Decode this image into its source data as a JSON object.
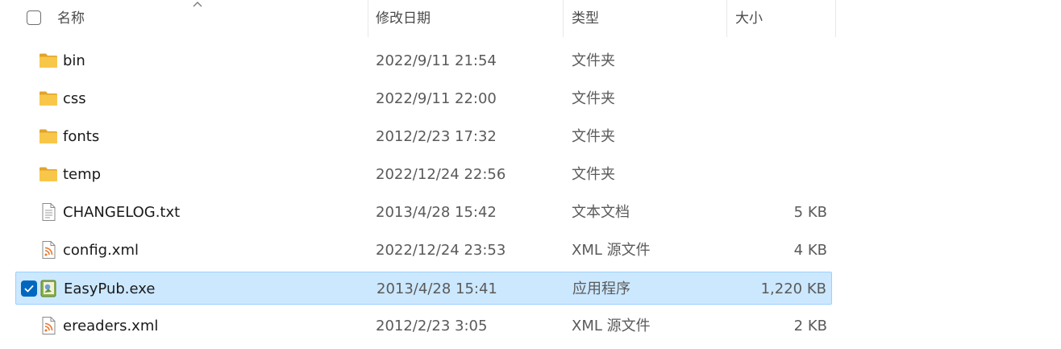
{
  "columns": {
    "name": "名称",
    "date": "修改日期",
    "type": "类型",
    "size": "大小"
  },
  "files": [
    {
      "name": "bin",
      "date": "2022/9/11 21:54",
      "type": "文件夹",
      "size": "",
      "icon": "folder-icon"
    },
    {
      "name": "css",
      "date": "2022/9/11 22:00",
      "type": "文件夹",
      "size": "",
      "icon": "folder-icon"
    },
    {
      "name": "fonts",
      "date": "2012/2/23 17:32",
      "type": "文件夹",
      "size": "",
      "icon": "folder-icon"
    },
    {
      "name": "temp",
      "date": "2022/12/24 22:56",
      "type": "文件夹",
      "size": "",
      "icon": "folder-icon"
    },
    {
      "name": "CHANGELOG.txt",
      "date": "2013/4/28 15:42",
      "type": "文本文档",
      "size": "5 KB",
      "icon": "text-file-icon"
    },
    {
      "name": "config.xml",
      "date": "2022/12/24 23:53",
      "type": "XML 源文件",
      "size": "4 KB",
      "icon": "xml-file-icon"
    },
    {
      "name": "EasyPub.exe",
      "date": "2013/4/28 15:41",
      "type": "应用程序",
      "size": "1,220 KB",
      "icon": "exe-file-icon",
      "selected": true
    },
    {
      "name": "ereaders.xml",
      "date": "2012/2/23 3:05",
      "type": "XML 源文件",
      "size": "2 KB",
      "icon": "xml-file-icon"
    }
  ],
  "colors": {
    "selection_bg": "#cce8ff",
    "selection_border": "#99d1ff",
    "checkbox_accent": "#0067c0",
    "folder_yellow": "#f8c74a",
    "xml_orange": "#e8772e"
  }
}
